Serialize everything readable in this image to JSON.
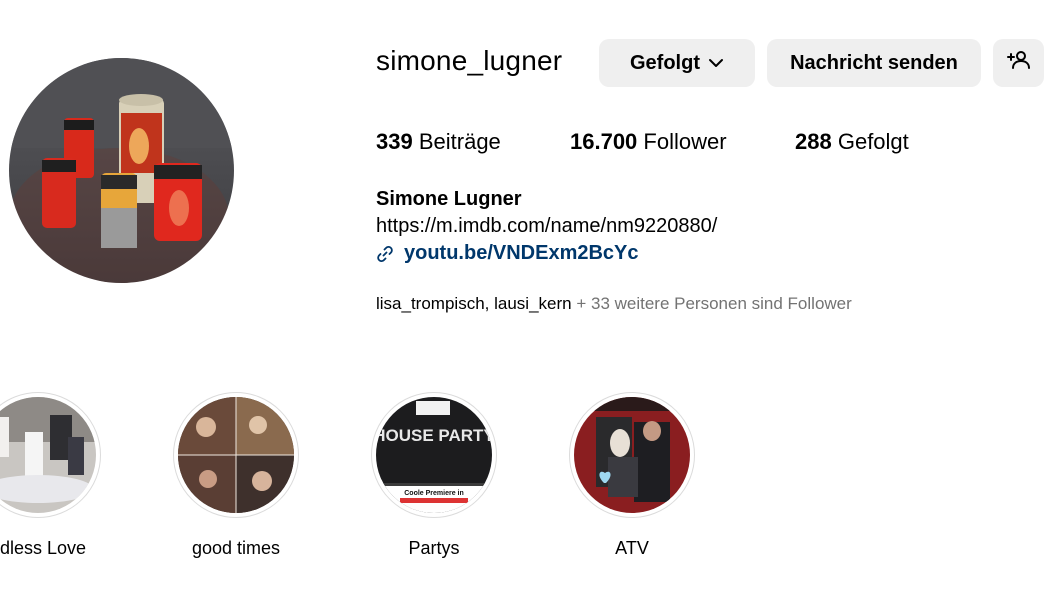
{
  "profile": {
    "username": "simone_lugner",
    "follow_button": "Gefolgt",
    "message_button": "Nachricht senden",
    "stats": {
      "posts_count": "339",
      "posts_label": "Beiträge",
      "followers_count": "16.700",
      "followers_label": "Follower",
      "following_count": "288",
      "following_label": "Gefolgt"
    },
    "full_name": "Simone Lugner",
    "bio_line": "https://m.imdb.com/name/nm9220880/",
    "link": "youtu.be/VNDExm2BcYc",
    "followed_by": {
      "user1": "lisa_trompisch",
      "separator": ", ",
      "user2": "lausi_kern",
      "rest": " + 33 weitere Personen sind Follower"
    }
  },
  "highlights": [
    {
      "label": "ndless Love"
    },
    {
      "label": "good times"
    },
    {
      "label": "Partys",
      "cover_title": "HOUSE PARTY",
      "cover_caption": "Coole Premiere in"
    },
    {
      "label": "ATV"
    }
  ],
  "icons": {
    "follow_dropdown": "chevron-down-icon",
    "add_user": "add-user-icon",
    "link": "link-icon"
  },
  "colors": {
    "button_bg": "#efefef",
    "link": "#00376b",
    "muted_text": "#737373"
  }
}
